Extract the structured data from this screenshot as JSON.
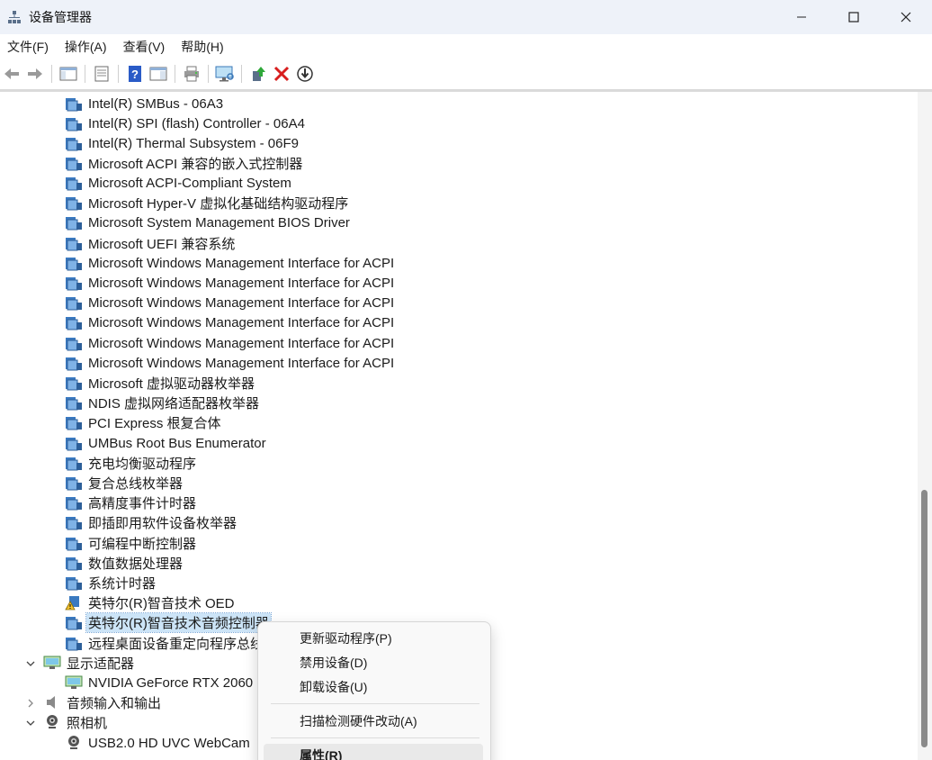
{
  "window": {
    "title": "设备管理器",
    "controls": {
      "minimize": "—",
      "maximize": "☐",
      "close": "✕"
    }
  },
  "menubar": {
    "items": [
      "文件(F)",
      "操作(A)",
      "查看(V)",
      "帮助(H)"
    ]
  },
  "toolbar": {
    "icons": [
      "back-icon",
      "forward-icon",
      "show-hide-console-tree-icon",
      "properties-icon",
      "help-icon",
      "action-pane-icon",
      "print-icon",
      "scan-hardware-icon",
      "update-driver-icon",
      "uninstall-icon",
      "disable-icon"
    ]
  },
  "tree": {
    "system_devices": [
      "Intel(R) SMBus - 06A3",
      "Intel(R) SPI (flash) Controller - 06A4",
      "Intel(R) Thermal Subsystem - 06F9",
      "Microsoft ACPI 兼容的嵌入式控制器",
      "Microsoft ACPI-Compliant System",
      "Microsoft Hyper-V 虚拟化基础结构驱动程序",
      "Microsoft System Management BIOS Driver",
      "Microsoft UEFI 兼容系统",
      "Microsoft Windows Management Interface for ACPI",
      "Microsoft Windows Management Interface for ACPI",
      "Microsoft Windows Management Interface for ACPI",
      "Microsoft Windows Management Interface for ACPI",
      "Microsoft Windows Management Interface for ACPI",
      "Microsoft Windows Management Interface for ACPI",
      "Microsoft 虚拟驱动器枚举器",
      "NDIS 虚拟网络适配器枚举器",
      "PCI Express 根复合体",
      "UMBus Root Bus Enumerator",
      "充电均衡驱动程序",
      "复合总线枚举器",
      "高精度事件计时器",
      "即插即用软件设备枚举器",
      "可编程中断控制器",
      "数值数据处理器",
      "系统计时器",
      "英特尔(R)智音技术 OED",
      "英特尔(R)智音技术音频控制器",
      "远程桌面设备重定向程序总线"
    ],
    "display_adapters": {
      "label": "显示适配器",
      "children": [
        "NVIDIA GeForce RTX 2060"
      ]
    },
    "audio_io": {
      "label": "音频输入和输出"
    },
    "cameras": {
      "label": "照相机",
      "children": [
        "USB2.0 HD UVC WebCam"
      ]
    }
  },
  "context_menu": {
    "items": [
      "更新驱动程序(P)",
      "禁用设备(D)",
      "卸载设备(U)",
      "扫描检测硬件改动(A)",
      "属性(R)"
    ]
  },
  "colors": {
    "titlebar_bg": "#eef2f9",
    "selection_bg": "#cce4f7",
    "uninstall_red": "#d81e1e",
    "help_blue": "#2a5bc7"
  }
}
